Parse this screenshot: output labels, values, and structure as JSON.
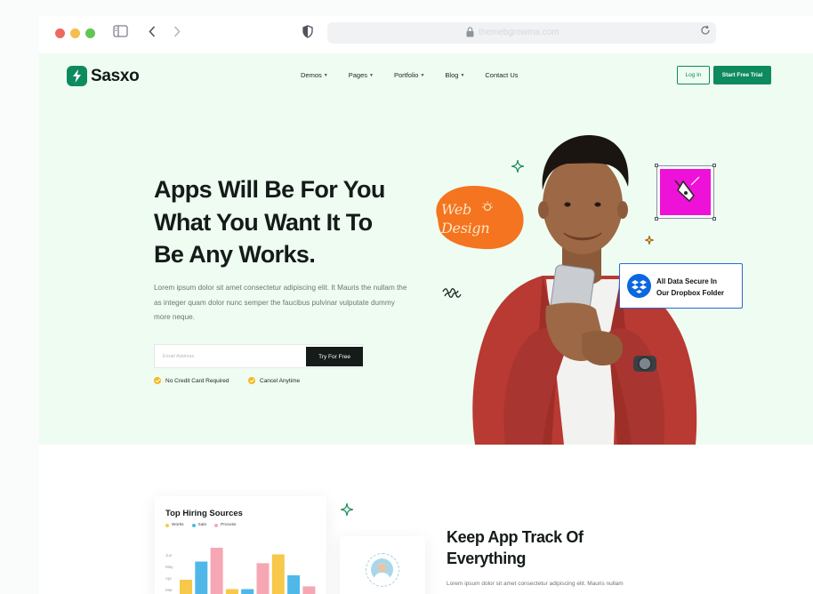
{
  "browser": {
    "url": "themebgrowma.com",
    "colors": {
      "close": "#ee6a5f",
      "minimize": "#f5be4f",
      "maximize": "#62c554"
    }
  },
  "brand": {
    "name": "Sasxo",
    "accent": "#0e8a5f"
  },
  "nav": {
    "items": [
      {
        "label": "Demos",
        "has_dropdown": true
      },
      {
        "label": "Pages",
        "has_dropdown": true
      },
      {
        "label": "Portfolio",
        "has_dropdown": true
      },
      {
        "label": "Blog",
        "has_dropdown": true
      },
      {
        "label": "Contact Us",
        "has_dropdown": false
      }
    ],
    "login_label": "Log In",
    "trial_label": "Start Free Trial"
  },
  "hero": {
    "headline_lines": [
      "Apps Will Be For You",
      "What You Want It To",
      "Be Any Works."
    ],
    "description": "Lorem ipsum dolor sit amet consectetur adipiscing elit. It Mauris the nullam the as integer quam dolor nunc semper the  faucibus pulvinar vulputate dummy more neque.",
    "email_placeholder": "Email Address",
    "cta_label": "Try For Free",
    "checks": [
      "No Credit Card Required",
      "Cancel Anytime"
    ],
    "web_design_badge": [
      "Web",
      "Design"
    ],
    "dropbox_badge": [
      "All Data Secure In",
      "Our Dropbox Folder"
    ]
  },
  "features": {
    "chart_card_title": "Top Hiring Sources",
    "legend": [
      {
        "name": "Works",
        "color": "#f8c84a"
      },
      {
        "name": "Sale",
        "color": "#4fb8e8"
      },
      {
        "name": "Process",
        "color": "#f6a7b4"
      }
    ],
    "title": "Keep App Track Of Everything",
    "description": "Lorem ipsum dolor sit amet consectetur adipiscing elit. Mauris nullam"
  },
  "chart_data": {
    "type": "bar",
    "title": "Top Hiring Sources",
    "categories": [
      "Jun",
      "May",
      "Apr",
      "Mar",
      "Feb"
    ],
    "series": [
      {
        "name": "Works",
        "values": [
          42,
          25,
          88
        ]
      },
      {
        "name": "Sale",
        "values": [
          75,
          25,
          50
        ]
      },
      {
        "name": "Process",
        "values": [
          100,
          72,
          30
        ]
      }
    ],
    "bar_order": [
      {
        "series": "Works",
        "value": 42
      },
      {
        "series": "Sale",
        "value": 75
      },
      {
        "series": "Process",
        "value": 100
      },
      {
        "series": "Works",
        "value": 25
      },
      {
        "series": "Sale",
        "value": 25
      },
      {
        "series": "Process",
        "value": 72
      },
      {
        "series": "Works",
        "value": 88
      },
      {
        "series": "Sale",
        "value": 50
      },
      {
        "series": "Process",
        "value": 30
      }
    ]
  }
}
